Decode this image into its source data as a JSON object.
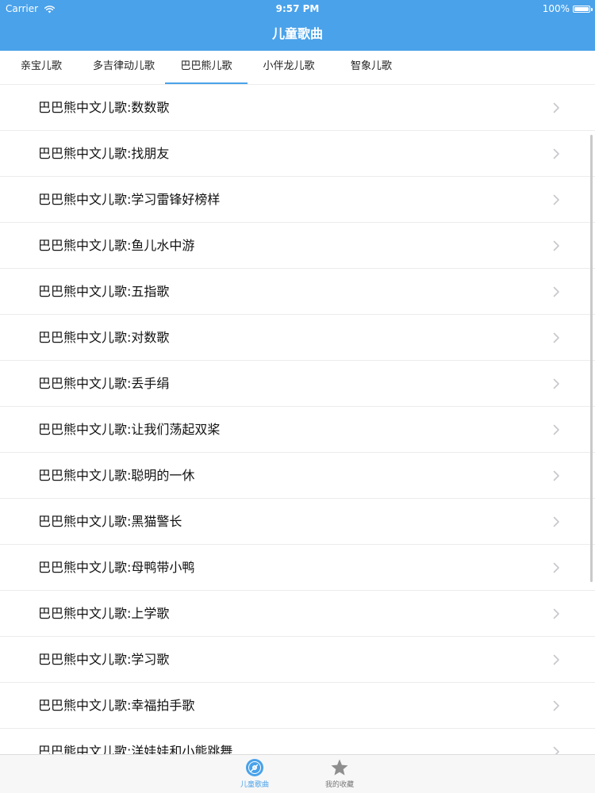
{
  "status_bar": {
    "carrier": "Carrier",
    "time": "9:57 PM",
    "battery": "100%",
    "battery_level": 1.0
  },
  "nav": {
    "title": "儿童歌曲"
  },
  "tabs": [
    {
      "label": "亲宝儿歌"
    },
    {
      "label": "多吉律动儿歌"
    },
    {
      "label": "巴巴熊儿歌"
    },
    {
      "label": "小伴龙儿歌"
    },
    {
      "label": "智象儿歌"
    }
  ],
  "active_tab": 2,
  "songs": [
    {
      "title": "巴巴熊中文儿歌:数数歌"
    },
    {
      "title": "巴巴熊中文儿歌:找朋友"
    },
    {
      "title": "巴巴熊中文儿歌:学习雷锋好榜样"
    },
    {
      "title": "巴巴熊中文儿歌:鱼儿水中游"
    },
    {
      "title": "巴巴熊中文儿歌:五指歌"
    },
    {
      "title": "巴巴熊中文儿歌:对数歌"
    },
    {
      "title": "巴巴熊中文儿歌:丢手绢"
    },
    {
      "title": "巴巴熊中文儿歌:让我们荡起双桨"
    },
    {
      "title": "巴巴熊中文儿歌:聪明的一休"
    },
    {
      "title": "巴巴熊中文儿歌:黑猫警长"
    },
    {
      "title": "巴巴熊中文儿歌:母鸭带小鸭"
    },
    {
      "title": "巴巴熊中文儿歌:上学歌"
    },
    {
      "title": "巴巴熊中文儿歌:学习歌"
    },
    {
      "title": "巴巴熊中文儿歌:幸福拍手歌"
    },
    {
      "title": "巴巴熊中文儿歌:洋娃娃和小熊跳舞"
    }
  ],
  "tabbar": {
    "items": [
      {
        "label": "儿童歌曲",
        "icon": "music-disc-icon"
      },
      {
        "label": "我的收藏",
        "icon": "star-icon"
      }
    ],
    "active": 0
  },
  "colors": {
    "accent": "#4aa2ea",
    "text": "#111111",
    "separator": "#ececec",
    "chevron": "#c7c7cc",
    "inactive_icon": "#8e8e8e"
  }
}
